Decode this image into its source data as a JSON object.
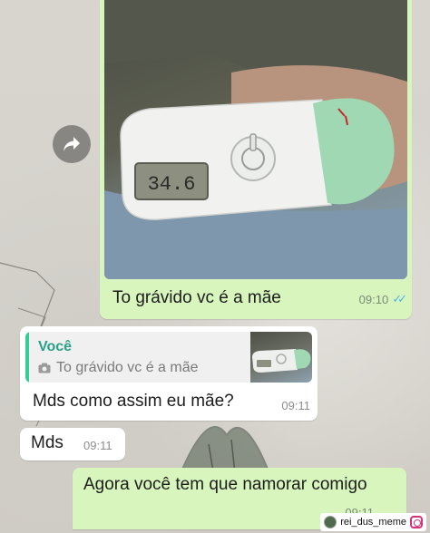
{
  "chat": {
    "messages": [
      {
        "type": "image",
        "direction": "outgoing",
        "caption": "To grávido vc é a mãe",
        "time": "09:10",
        "status": "read",
        "thermometer_display": "34.6"
      },
      {
        "type": "reply",
        "direction": "incoming",
        "quoted_author": "Você",
        "quoted_text": "To grávido vc é a mãe",
        "text": "Mds como assim  eu mãe?",
        "time": "09:11"
      },
      {
        "type": "text",
        "direction": "incoming",
        "text": "Mds",
        "time": "09:11"
      },
      {
        "type": "text",
        "direction": "outgoing",
        "text": "Agora você tem que namorar comigo",
        "time": "09:11"
      }
    ]
  },
  "watermark": {
    "handle": "rei_dus_meme"
  },
  "colors": {
    "outgoing_bubble": "#d7f5bd",
    "incoming_bubble": "#ffffff",
    "quote_accent": "#35cd96",
    "read_ticks": "#4fb6ec"
  },
  "icons": [
    "forward-icon",
    "camera-icon",
    "double-check-icon",
    "instagram-icon"
  ]
}
